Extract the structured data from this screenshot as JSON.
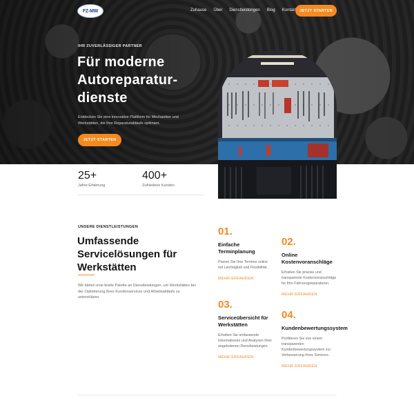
{
  "brand": {
    "logo_text": "FZ-MW"
  },
  "nav": {
    "items": [
      "Zuhause",
      "Über",
      "Dienstleistungen",
      "Blog",
      "Kontakt"
    ],
    "cta": "JETZT STARTEN"
  },
  "hero": {
    "eyebrow": "IHR ZUVERLÄSSIGER PARTNER",
    "title": "Für moderne Autoreparatur-dienste",
    "description": "Entdecken Sie eine innovative Plattform für Mechaniker und Werkstätten, die Ihre Reparaturabläufe optimiert.",
    "cta": "JETZT STARTEN"
  },
  "stats": [
    {
      "value": "25+",
      "label": "Jahre Erfahrung"
    },
    {
      "value": "400+",
      "label": "Zufriedene Kunden"
    }
  ],
  "services": {
    "eyebrow": "UNSERE DIENSTLEISTUNGEN",
    "title": "Umfassende Servicelösungen für Werkstätten",
    "description": "Wir bieten eine breite Palette an Dienstleistungen, um Werkstätten bei der Optimierung ihres Kundenservices und Arbeitsabläufs zu unterstützen.",
    "cards": [
      {
        "number": "01.",
        "title": "Einfache Terminplanung",
        "text": "Planen Sie Ihre Termine online mit Leichtigkeit und Flexibilität.",
        "link": "MEHR ERFAHREN"
      },
      {
        "number": "02.",
        "title": "Online Kostenvoranschläge",
        "text": "Erhalten Sie präzise und transparente Kostenvoranschläge für Ihre Fahrzeugreparaturen.",
        "link": "MEHR ERFAHREN"
      },
      {
        "number": "03.",
        "title": "Serviceübersicht für Werkstätten",
        "text": "Erhalten Sie umfassende Informationen und Analysen Ihrer angebotenen Dienstleistungen.",
        "link": "MEHR ERFAHREN"
      },
      {
        "number": "04.",
        "title": "Kundenbewertungssystem",
        "text": "Profitieren Sie von einem transparenten Kundenbewertungssystem zur Verbesserung Ihres Services.",
        "link": "MEHR ERFAHREN"
      }
    ]
  },
  "colors": {
    "accent": "#f58a1f",
    "dark": "#151515",
    "muted": "#666666"
  }
}
